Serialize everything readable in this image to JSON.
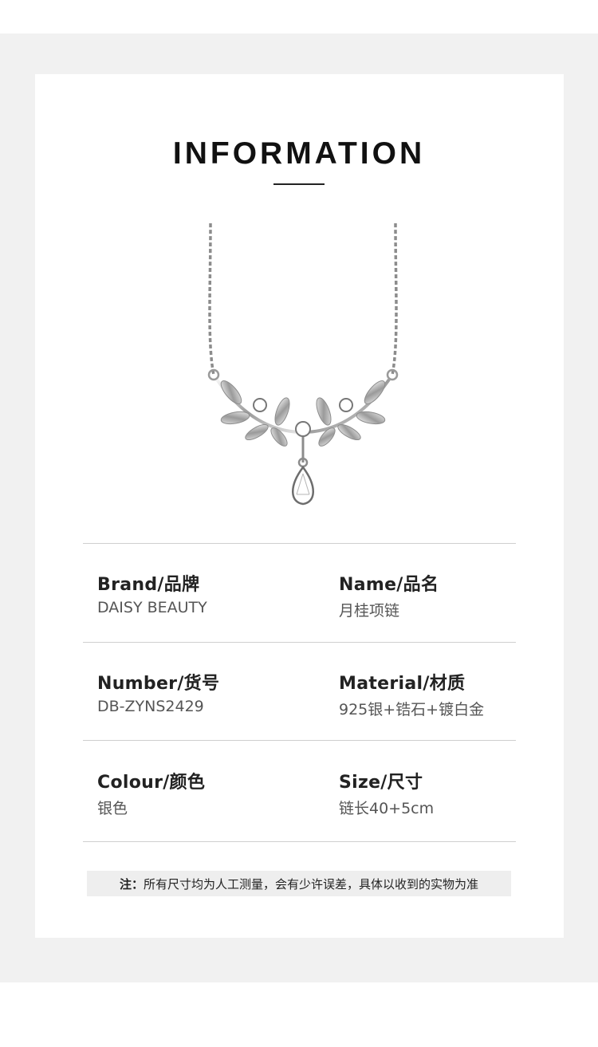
{
  "header": {
    "title": "INFORMATION"
  },
  "product_image": {
    "alt": "laurel leaf necklace with zircon drop"
  },
  "specs": {
    "brand": {
      "label": "Brand/品牌",
      "value": "DAISY BEAUTY"
    },
    "name": {
      "label": "Name/品名",
      "value": "月桂项链"
    },
    "number": {
      "label": "Number/货号",
      "value": "DB-ZYNS2429"
    },
    "material": {
      "label": "Material/材质",
      "value": "925银+锆石+镀白金"
    },
    "colour": {
      "label": "Colour/颜色",
      "value": "银色"
    },
    "size": {
      "label": "Size/尺寸",
      "value": "链长40+5cm"
    }
  },
  "note": {
    "prefix": "注：",
    "text": "所有尺寸均为人工测量，会有少许误差，具体以收到的实物为准"
  },
  "colors": {
    "band": "#f1f1f1",
    "card": "#ffffff",
    "rule": "#cfcfcf",
    "note_bg": "#eeeeee"
  }
}
